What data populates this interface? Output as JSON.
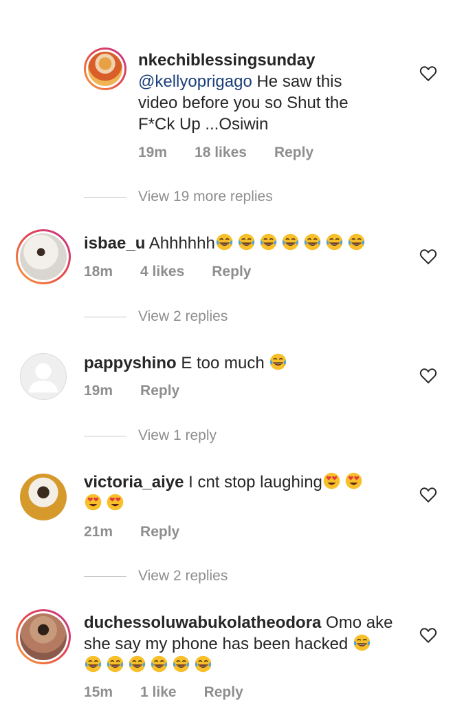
{
  "comments": [
    {
      "username": "nkechiblessingsunday",
      "mention": "@kellyoprigago",
      "line1_rest": " He saw this",
      "line2": "video before you so Shut the",
      "line3": "F*Ck Up ...Osiwin",
      "time": "19m",
      "likes": "18 likes",
      "reply": "Reply"
    },
    {
      "username": "isbae_u",
      "text": " Ahhhhhh",
      "emoji": "laughing-tears-emoji x7",
      "time": "18m",
      "likes": "4 likes",
      "reply": "Reply"
    },
    {
      "username": "pappyshino",
      "text": " E too much ",
      "emoji": "laughing-tears-emoji",
      "time": "19m",
      "reply": "Reply"
    },
    {
      "username": "victoria_aiye",
      "text": " I cnt stop laughing",
      "emoji": "heart-eyes-emoji x4",
      "time": "21m",
      "reply": "Reply"
    },
    {
      "username": "duchessoluwabukolatheodora",
      "text": " Omo ake",
      "line2": "she say my phone has been hacked ",
      "emoji": "laughing-tears-emoji x7",
      "time": "15m",
      "likes": "1 like",
      "reply": "Reply"
    }
  ],
  "view_replies": [
    "View 19 more replies",
    "View 2 replies",
    "View 1 reply",
    "View 2 replies"
  ],
  "icons": {
    "like": "heart-outline-icon"
  },
  "colors": {
    "mention": "#1b3f7a",
    "meta": "#8e8e8e",
    "text": "#262626"
  }
}
